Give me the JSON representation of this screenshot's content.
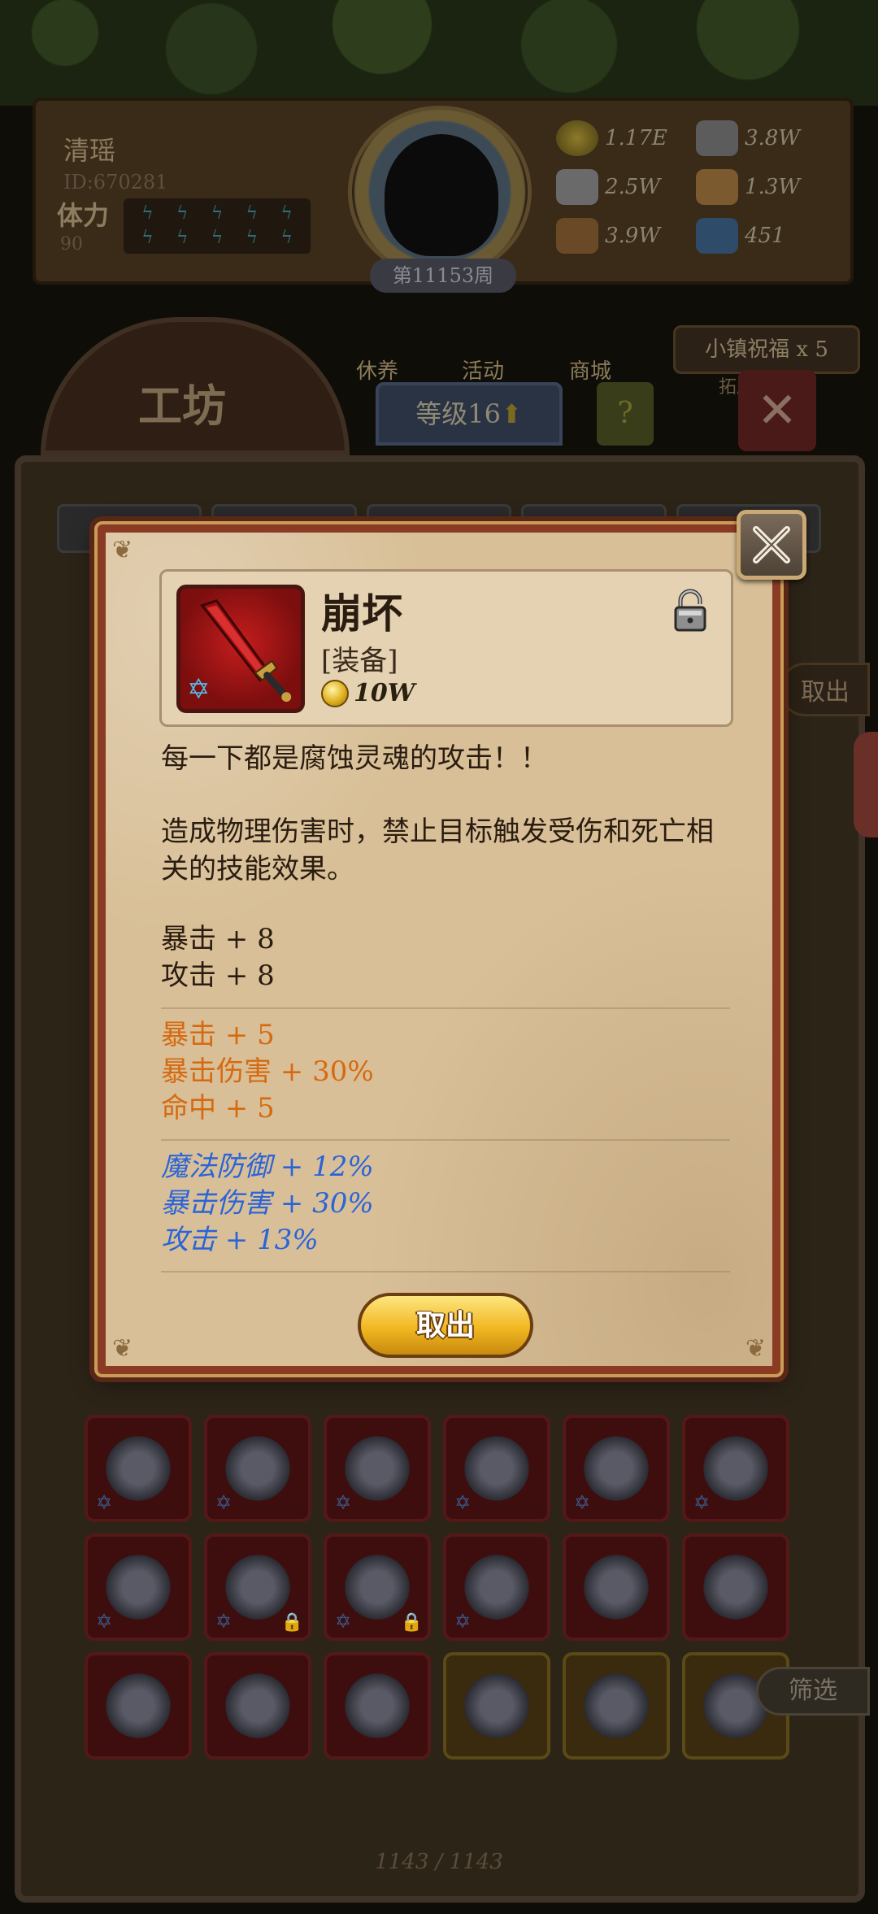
{
  "header": {
    "player_name": "清瑶",
    "player_id": "ID:670281",
    "stamina_label": "体力",
    "stamina_value": "90",
    "week_badge": "第11153周",
    "resources": [
      {
        "name": "gold-coin",
        "value": "1.17E"
      },
      {
        "name": "iron-ingot",
        "value": "3.8W"
      },
      {
        "name": "stone",
        "value": "2.5W"
      },
      {
        "name": "cloth",
        "value": "1.3W"
      },
      {
        "name": "wood",
        "value": "3.9W"
      },
      {
        "name": "crystal",
        "value": "451"
      }
    ]
  },
  "nav": {
    "items": [
      "休养",
      "活动",
      "商城"
    ],
    "blessing": "小镇祝福 x 5",
    "blessing_sub": "拓魔石"
  },
  "workshop": {
    "title": "工坊",
    "level": "等级16",
    "help": "?",
    "side_take": "取出",
    "filter": "筛选",
    "page_counter": "1143 / 1143"
  },
  "modal": {
    "item": {
      "name": "崩坏",
      "type": "[装备]",
      "price": "10W"
    },
    "flavor": "每一下都是腐蚀灵魂的攻击！！",
    "effect": "造成物理伤害时，禁止目标触发受伤和死亡相关的技能效果。",
    "base_stats": [
      "暴击 + 8",
      "攻击 + 8"
    ],
    "orange_stats": [
      "暴击 + 5",
      "暴击伤害 + 30%",
      "命中 + 5"
    ],
    "blue_stats": [
      "魔法防御 + 12%",
      "暴击伤害 + 30%",
      "攻击 + 13%"
    ],
    "take_button": "取出"
  },
  "colors": {
    "orange_stat": "#d66a10",
    "blue_stat": "#2a64d8",
    "modal_bg": "#d8bf97",
    "modal_border": "#8b3a24"
  }
}
